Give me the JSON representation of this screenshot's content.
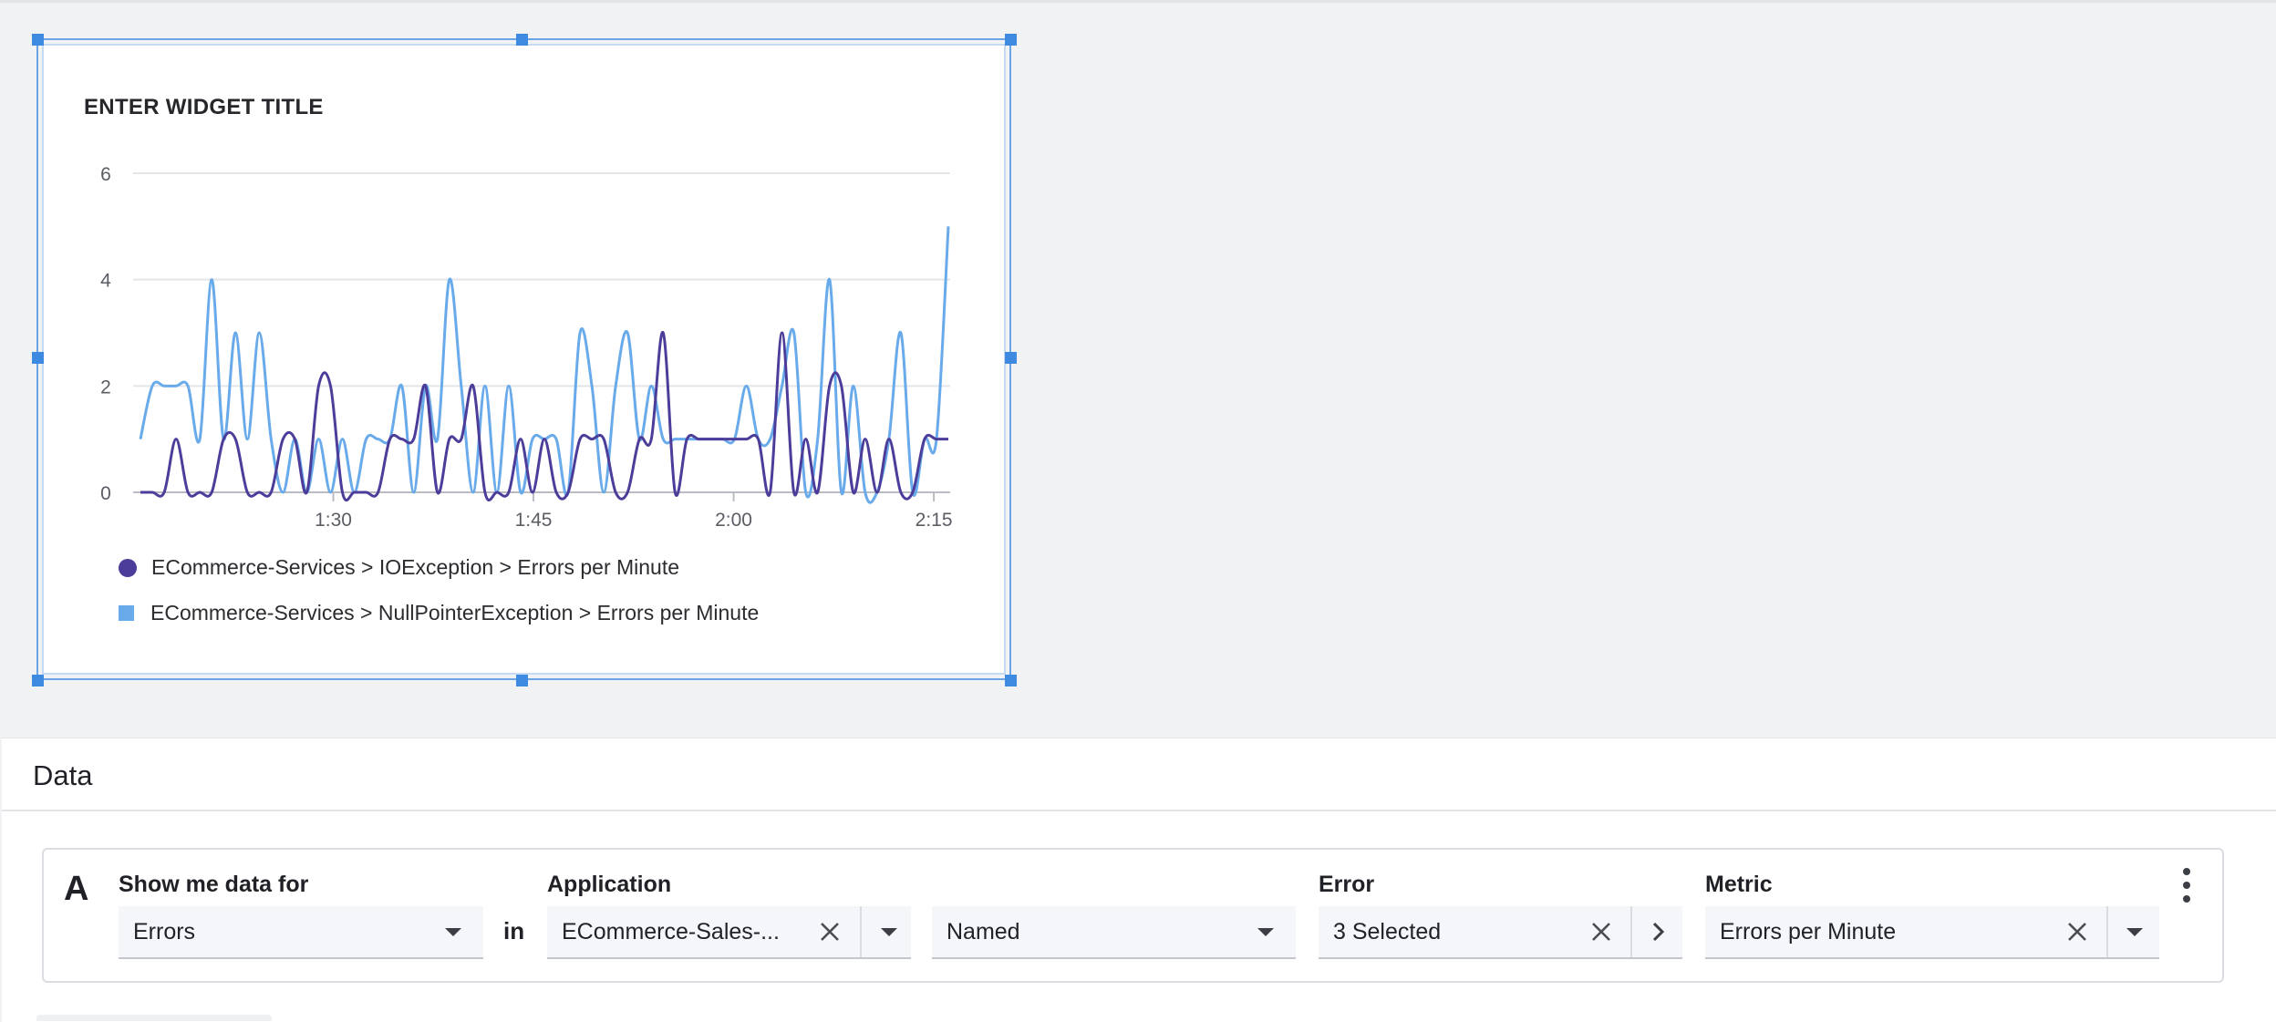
{
  "widget": {
    "title": "ENTER WIDGET TITLE",
    "legend": [
      {
        "label": "ECommerce-Services > IOException > Errors per Minute",
        "color": "#4c3d9a"
      },
      {
        "label": "ECommerce-Services > NullPointerException > Errors per Minute",
        "color": "#68aaea"
      }
    ]
  },
  "chart_data": {
    "type": "line",
    "x_ticks": [
      "1:30",
      "1:45",
      "2:00",
      "2:15"
    ],
    "y_ticks": [
      0,
      2,
      4,
      6
    ],
    "ylim": [
      0,
      6
    ],
    "series": [
      {
        "name": "ECommerce-Services > IOException > Errors per Minute",
        "color": "#4c3d9a",
        "values": [
          0,
          0,
          0,
          1,
          0,
          0,
          0,
          1,
          1,
          0,
          0,
          0,
          1,
          1,
          0,
          2,
          2,
          0,
          0,
          0,
          0,
          1,
          1,
          1,
          2,
          0,
          1,
          1,
          2,
          0,
          0,
          0,
          1,
          0,
          1,
          0,
          0,
          1,
          1,
          1,
          0,
          0,
          1,
          1,
          3,
          0,
          1,
          1,
          1,
          1,
          1,
          1,
          1,
          0,
          3,
          0,
          1,
          0,
          2,
          2,
          0,
          1,
          0,
          1,
          0,
          0,
          1,
          1,
          1
        ]
      },
      {
        "name": "ECommerce-Services > NullPointerException > Errors per Minute",
        "color": "#68aaea",
        "values": [
          1,
          2,
          2,
          2,
          2,
          1,
          4,
          1,
          3,
          1,
          3,
          1,
          0,
          1,
          0,
          1,
          0,
          1,
          0,
          1,
          1,
          1,
          2,
          0,
          2,
          1,
          4,
          2,
          0,
          2,
          0,
          2,
          0,
          1,
          1,
          1,
          0,
          3,
          2,
          0,
          2,
          3,
          1,
          2,
          1,
          1,
          1,
          1,
          1,
          1,
          1,
          2,
          1,
          1,
          2,
          3,
          0,
          1,
          4,
          0,
          2,
          0,
          0,
          1,
          3,
          0,
          1,
          1,
          5
        ]
      }
    ]
  },
  "data_panel": {
    "title": "Data",
    "query": {
      "letter": "A",
      "show_label": "Show me data for",
      "show_value": "Errors",
      "in_label": "in",
      "application_label": "Application",
      "application_value": "ECommerce-Sales-...",
      "named_value": "Named",
      "error_label": "Error",
      "error_value": "3 Selected",
      "metric_label": "Metric",
      "metric_value": "Errors per Minute"
    }
  }
}
